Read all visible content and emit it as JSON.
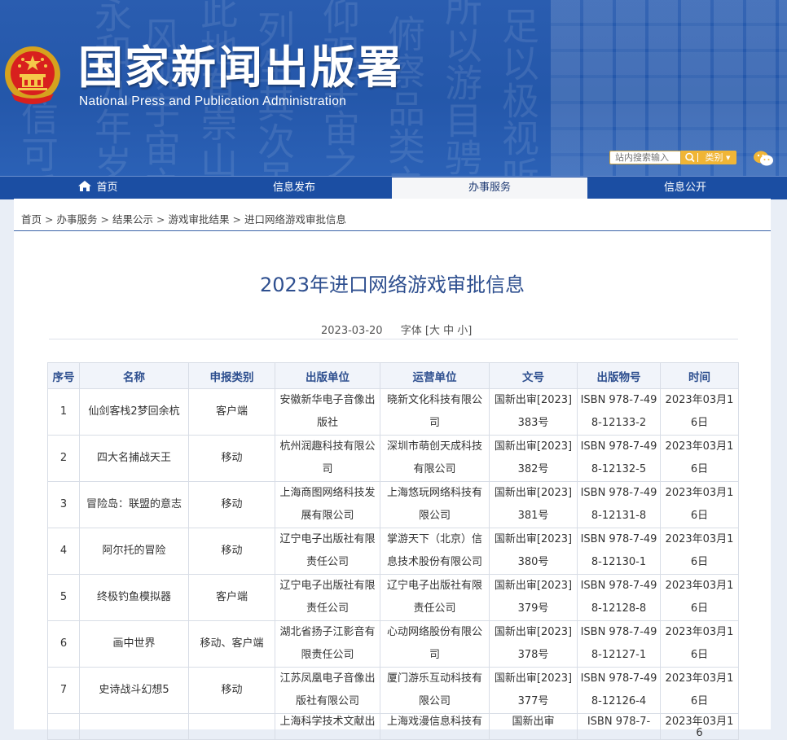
{
  "header": {
    "title": "国家新闻出版署",
    "subtitle": "National  Press and Publication Administration",
    "search_placeholder": "站内搜索输入",
    "category_label": "类别",
    "colors": {
      "banner": "#2457aa",
      "nav": "#1b4ea3",
      "accent": "#f0b536",
      "title_blue": "#2e4f8f"
    }
  },
  "nav": [
    {
      "label": "首页",
      "icon": "home-icon"
    },
    {
      "label": "信息发布"
    },
    {
      "label": "办事服务",
      "active": true
    },
    {
      "label": "信息公开"
    }
  ],
  "breadcrumb": [
    "首页",
    "办事服务",
    "结果公示",
    "游戏审批结果",
    "进口网络游戏审批信息"
  ],
  "breadcrumb_separator": ">",
  "article": {
    "title": "2023年进口网络游戏审批信息",
    "date": "2023-03-20",
    "font_size_label": "字体",
    "font_size_open": "[",
    "font_large": "大",
    "font_medium": "中",
    "font_small": "小",
    "font_size_close": "]"
  },
  "table": {
    "headers": [
      "序号",
      "名称",
      "申报类别",
      "出版单位",
      "运营单位",
      "文号",
      "出版物号",
      "时间"
    ],
    "rows": [
      [
        "1",
        "仙剑客栈2梦回余杭",
        "客户端",
        "安徽新华电子音像出版社",
        "晓新文化科技有限公司",
        "国新出审[2023]383号",
        "ISBN 978-7-498-12133-2",
        "2023年03月16日"
      ],
      [
        "2",
        "四大名捕战天王",
        "移动",
        "杭州润趣科技有限公司",
        "深圳市萌创天成科技有限公司",
        "国新出审[2023]382号",
        "ISBN 978-7-498-12132-5",
        "2023年03月16日"
      ],
      [
        "3",
        "冒险岛：联盟的意志",
        "移动",
        "上海商图网络科技发展有限公司",
        "上海悠玩网络科技有限公司",
        "国新出审[2023]381号",
        "ISBN 978-7-498-12131-8",
        "2023年03月16日"
      ],
      [
        "4",
        "阿尔托的冒险",
        "移动",
        "辽宁电子出版社有限责任公司",
        "掌游天下（北京）信息技术股份有限公司",
        "国新出审[2023]380号",
        "ISBN 978-7-498-12130-1",
        "2023年03月16日"
      ],
      [
        "5",
        "终极钓鱼模拟器",
        "客户端",
        "辽宁电子出版社有限责任公司",
        "辽宁电子出版社有限责任公司",
        "国新出审[2023]379号",
        "ISBN 978-7-498-12128-8",
        "2023年03月16日"
      ],
      [
        "6",
        "画中世界",
        "移动、客户端",
        "湖北省扬子江影音有限责任公司",
        "心动网络股份有限公司",
        "国新出审[2023]378号",
        "ISBN 978-7-498-12127-1",
        "2023年03月16日"
      ],
      [
        "7",
        "史诗战斗幻想5",
        "移动",
        "江苏凤凰电子音像出版社有限公司",
        "厦门游乐互动科技有限公司",
        "国新出审[2023]377号",
        "ISBN 978-7-498-12126-4",
        "2023年03月16日"
      ]
    ],
    "partial_row": [
      "",
      "",
      "",
      "上海科学技术文献出",
      "上海戏漫信息科技有",
      "国新出审",
      "ISBN 978-7-",
      "2023年03月16"
    ]
  }
}
